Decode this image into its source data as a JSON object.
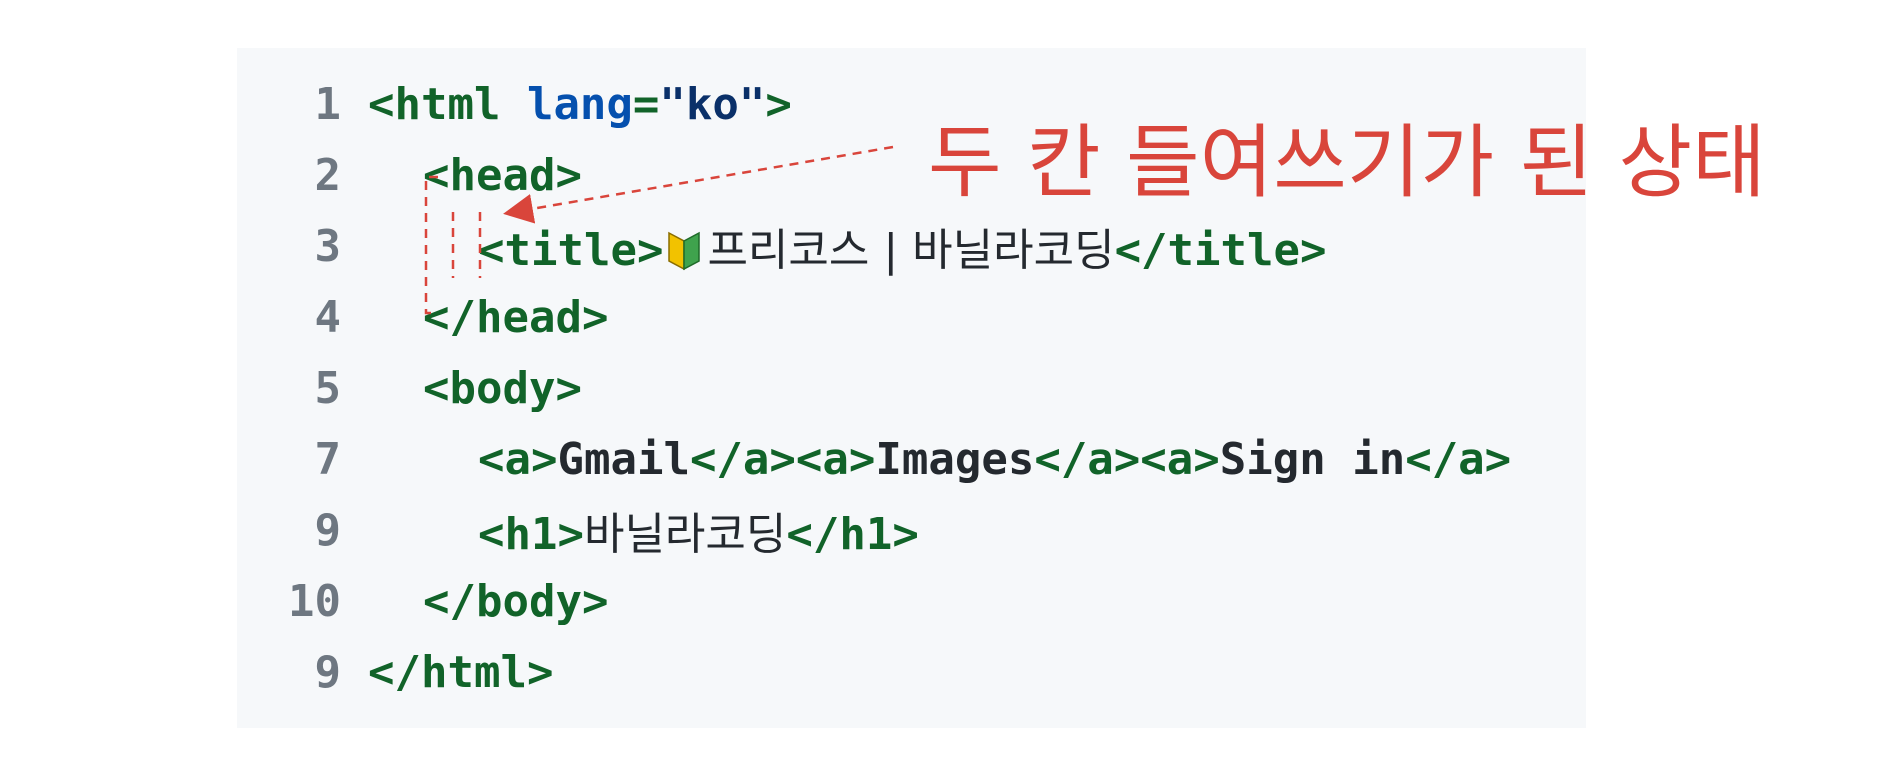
{
  "annotation": "두 칸 들여쓰기가 된 상태",
  "lines": [
    {
      "num": "1",
      "parts": [
        {
          "cls": "tag",
          "text": "<html "
        },
        {
          "cls": "attr",
          "text": "lang"
        },
        {
          "cls": "tag",
          "text": "="
        },
        {
          "cls": "str",
          "text": "\"ko\""
        },
        {
          "cls": "tag",
          "text": ">"
        }
      ]
    },
    {
      "num": "2",
      "parts": [
        {
          "cls": "tag",
          "text": "<head>"
        }
      ]
    },
    {
      "num": "3",
      "parts": [
        {
          "cls": "tag",
          "text": "<title>"
        },
        {
          "cls": "badge",
          "text": ""
        },
        {
          "cls": "txt",
          "text": "프리코스 | 바닐라코딩"
        },
        {
          "cls": "tag",
          "text": "</title>"
        }
      ]
    },
    {
      "num": "4",
      "parts": [
        {
          "cls": "tag",
          "text": "</head>"
        }
      ]
    },
    {
      "num": "5",
      "parts": [
        {
          "cls": "tag",
          "text": "<body>"
        }
      ]
    },
    {
      "num": "7",
      "parts": [
        {
          "cls": "tag",
          "text": "<a>"
        },
        {
          "cls": "plain",
          "text": "Gmail"
        },
        {
          "cls": "tag",
          "text": "</a><a>"
        },
        {
          "cls": "plain",
          "text": "Images"
        },
        {
          "cls": "tag",
          "text": "</a><a>"
        },
        {
          "cls": "plain",
          "text": "Sign in"
        },
        {
          "cls": "tag",
          "text": "</a>"
        }
      ]
    },
    {
      "num": "9",
      "parts": [
        {
          "cls": "tag",
          "text": "<h1>"
        },
        {
          "cls": "txt",
          "text": "바닐라코딩"
        },
        {
          "cls": "tag",
          "text": "</h1>"
        }
      ]
    },
    {
      "num": "10",
      "parts": [
        {
          "cls": "tag",
          "text": "</body>"
        }
      ]
    },
    {
      "num": "9",
      "parts": [
        {
          "cls": "tag",
          "text": "</html>"
        }
      ]
    }
  ],
  "colors": {
    "tag": "#116329",
    "attr": "#0550ae",
    "string": "#0a3069",
    "annotation": "#d9453b",
    "panel": "#f6f8fa"
  },
  "icons": {
    "beginner-badge": "beginner-badge-icon"
  }
}
